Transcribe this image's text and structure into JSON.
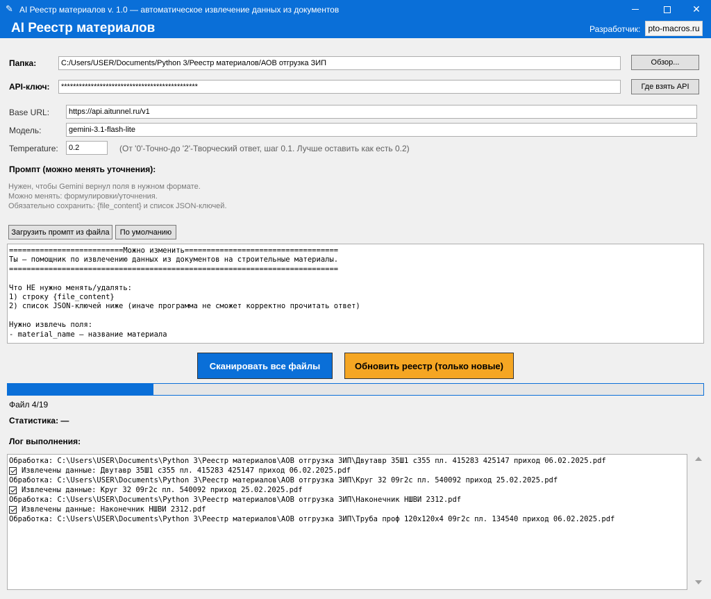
{
  "window": {
    "title": "AI Реестр материалов v. 1.0 — автоматическое извлечение данных из документов",
    "icon": "feather-icon"
  },
  "header": {
    "app_title": "AI Реестр материалов",
    "developer_label": "Разработчик:",
    "developer_link": "pto-macros.ru"
  },
  "form": {
    "folder_label": "Папка:",
    "folder_value": "C:/Users/USER/Documents/Python 3/Реестр материалов/АОВ отгрузка ЗИП",
    "browse_button": "Обзор...",
    "api_key_label": "API-ключ:",
    "api_key_value": "**********************************************",
    "get_api_button": "Где взять API",
    "base_url_label": "Base URL:",
    "base_url_value": "https://api.aitunnel.ru/v1",
    "model_label": "Модель:",
    "model_value": "gemini-3.1-flash-lite",
    "temperature_label": "Temperature:",
    "temperature_value": "0.2",
    "temperature_hint": "(От '0'-Точно-до '2'-Творческий ответ, шаг 0.1. Лучше оставить как есть 0.2)"
  },
  "prompt": {
    "heading": "Промпт (можно менять уточнения):",
    "help_lines": [
      "Нужен, чтобы Gemini вернул поля в нужном формате.",
      "Можно менять: формулировки/уточнения.",
      "Обязательно сохранить: {file_content} и список JSON-ключей."
    ],
    "load_button": "Загрузить промпт из файла",
    "default_button": "По умолчанию",
    "text_lines": [
      "==========================Можно изменить===================================",
      "Ты — помощник по извлечению данных из документов на строительные материалы.",
      "===========================================================================",
      "",
      "Что НЕ нужно менять/удалять:",
      "1) строку {file_content}",
      "2) список JSON-ключей ниже (иначе программа не сможет корректно прочитать ответ)",
      "",
      "Нужно извлечь поля:",
      "- material_name — название материала"
    ]
  },
  "actions": {
    "scan_button": "Сканировать все файлы",
    "update_button": "Обновить реестр (только новые)"
  },
  "progress": {
    "current": 4,
    "total": 19,
    "fraction": 0.21,
    "label": "Файл 4/19"
  },
  "stats_label": "Статистика: —",
  "log": {
    "heading": "Лог выполнения:",
    "lines": [
      {
        "check": false,
        "text": "Обработка: C:\\Users\\USER\\Documents\\Python 3\\Реестр материалов\\АОВ отгрузка ЗИП\\Двутавр 35Ш1 с355 пл. 415283 425147 приход 06.02.2025.pdf"
      },
      {
        "check": true,
        "text": "Извлечены данные: Двутавр 35Ш1 с355 пл. 415283 425147 приход 06.02.2025.pdf"
      },
      {
        "check": false,
        "text": "Обработка: C:\\Users\\USER\\Documents\\Python 3\\Реестр материалов\\АОВ отгрузка ЗИП\\Круг 32 09г2с пл. 540092 приход 25.02.2025.pdf"
      },
      {
        "check": true,
        "text": "Извлечены данные: Круг 32 09г2с пл. 540092 приход 25.02.2025.pdf"
      },
      {
        "check": false,
        "text": "Обработка: C:\\Users\\USER\\Documents\\Python 3\\Реестр материалов\\АОВ отгрузка ЗИП\\Наконечник НШВИ 2312.pdf"
      },
      {
        "check": true,
        "text": "Извлечены данные: Наконечник НШВИ 2312.pdf"
      },
      {
        "check": false,
        "text": "Обработка: C:\\Users\\USER\\Documents\\Python 3\\Реестр материалов\\АОВ отгрузка ЗИП\\Труба проф 120х120х4 09г2с пл. 134540 приход 06.02.2025.pdf"
      }
    ]
  },
  "colors": {
    "accent": "#0a6fd8",
    "orange": "#f5a623",
    "background": "#f0f0f0"
  }
}
